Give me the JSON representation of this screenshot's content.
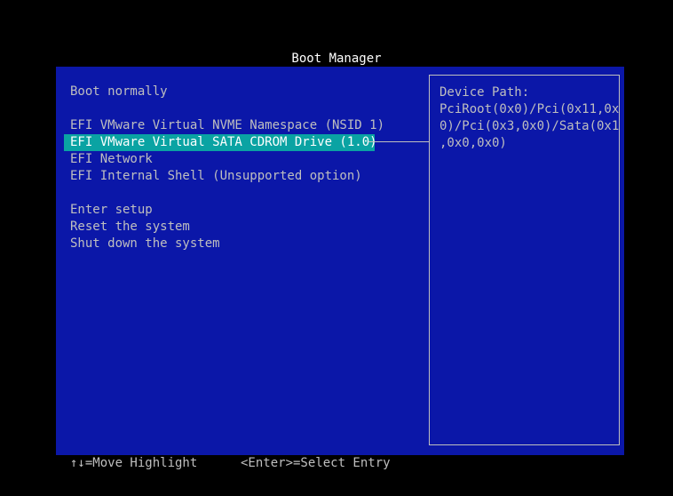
{
  "header": {
    "title": "Boot Manager"
  },
  "menu": {
    "items": [
      {
        "label": "Boot normally"
      },
      {
        "label": "EFI VMware Virtual NVME Namespace (NSID 1)"
      },
      {
        "label": "EFI VMware Virtual SATA CDROM Drive (1.0)",
        "selected": true
      },
      {
        "label": "EFI Network"
      },
      {
        "label": "EFI Internal Shell (Unsupported option)"
      },
      {
        "label": "Enter setup"
      },
      {
        "label": "Reset the system"
      },
      {
        "label": "Shut down the system"
      }
    ]
  },
  "info_panel": {
    "title": "Device Path:",
    "lines": [
      "PciRoot(0x0)/Pci(0x11,0x",
      "0)/Pci(0x3,0x0)/Sata(0x1",
      ",0x0,0x0)"
    ]
  },
  "footer": {
    "move_hint": "↑↓=Move Highlight",
    "select_hint": "<Enter>=Select Entry"
  },
  "colors": {
    "background": "#0b17a8",
    "highlight": "#0aa3a3",
    "text": "#bfbfbf",
    "title_text": "#ffffff"
  }
}
